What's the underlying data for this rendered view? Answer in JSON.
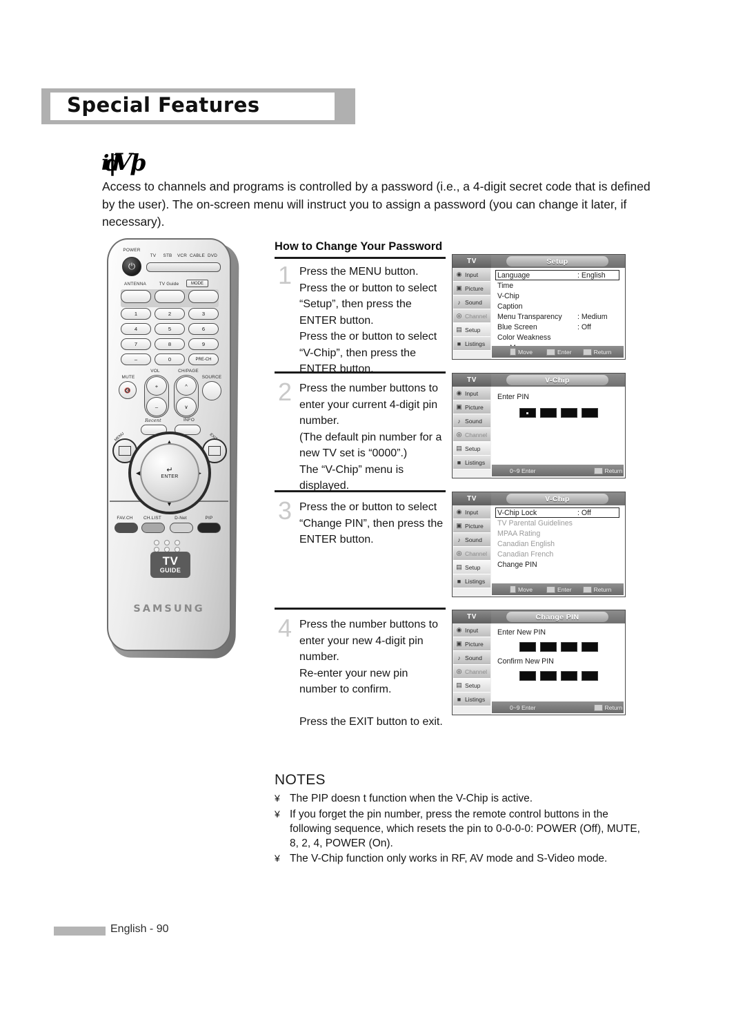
{
  "header": {
    "title": "Special Features"
  },
  "section": {
    "glyphs": [
      "i",
      "d",
      "V",
      "þ",
      "|"
    ],
    "intro": "Access to channels and programs is controlled by a password (i.e., a 4-digit secret code that is defined by the user). The on-screen menu will instruct you to assign a password (you can change it later, if necessary)."
  },
  "howto": {
    "title": "How to Change Your Password"
  },
  "steps": [
    {
      "num": "1",
      "text": "Press the MENU button.\nPress the      or      button to select “Setup”, then press the ENTER button.\nPress the      or      button to select “V-Chip”, then press the ENTER button."
    },
    {
      "num": "2",
      "text": "Press the number buttons to enter your current 4-digit pin number.\n(The default pin number for a new TV set is “0000”.)\nThe “V-Chip” menu is displayed."
    },
    {
      "num": "3",
      "text": "Press the      or      button to select “Change PIN”, then press the ENTER button."
    },
    {
      "num": "4",
      "text": "Press the number buttons to enter your new 4-digit pin number.\nRe-enter your new pin number to confirm.\n\nPress the EXIT button to exit."
    }
  ],
  "osd_sidebar": {
    "tv_label": "TV",
    "items": [
      {
        "label": "Input",
        "icon": "input-icon"
      },
      {
        "label": "Picture",
        "icon": "picture-icon"
      },
      {
        "label": "Sound",
        "icon": "sound-icon"
      },
      {
        "label": "Channel",
        "icon": "channel-icon"
      },
      {
        "label": "Setup",
        "icon": "setup-icon"
      },
      {
        "label": "Listings",
        "icon": "tvguide-icon"
      }
    ]
  },
  "osd_footer": {
    "move": "Move",
    "enter": "Enter",
    "return": "Return",
    "numeric": "0~9 Enter"
  },
  "osd_screens": [
    {
      "title": "Setup",
      "rows": [
        {
          "label": "Language",
          "value": ": English",
          "selected": true,
          "dim": false
        },
        {
          "label": "Time",
          "value": "",
          "selected": false,
          "dim": false
        },
        {
          "label": "V-Chip",
          "value": "",
          "selected": false,
          "dim": false
        },
        {
          "label": "Caption",
          "value": "",
          "selected": false,
          "dim": false
        },
        {
          "label": "Menu Transparency",
          "value": ": Medium",
          "selected": false,
          "dim": false
        },
        {
          "label": "Blue Screen",
          "value": ": Off",
          "selected": false,
          "dim": false
        },
        {
          "label": "Color Weakness",
          "value": "",
          "selected": false,
          "dim": false
        },
        {
          "label": "More",
          "value": "",
          "selected": false,
          "dim": false
        }
      ]
    },
    {
      "title": "V-Chip",
      "prompt": "Enter PIN",
      "pin_boxes": 4
    },
    {
      "title": "V-Chip",
      "rows": [
        {
          "label": "V-Chip Lock",
          "value": ": Off",
          "selected": true,
          "dim": false
        },
        {
          "label": "TV Parental Guidelines",
          "value": "",
          "selected": false,
          "dim": true
        },
        {
          "label": "MPAA Rating",
          "value": "",
          "selected": false,
          "dim": true
        },
        {
          "label": "Canadian English",
          "value": "",
          "selected": false,
          "dim": true
        },
        {
          "label": "Canadian French",
          "value": "",
          "selected": false,
          "dim": true
        },
        {
          "label": "Change PIN",
          "value": "",
          "selected": false,
          "dim": false
        }
      ]
    },
    {
      "title": "Change PIN",
      "prompt": "Enter New PIN",
      "prompt2": "Confirm New PIN",
      "pin_boxes": 4
    }
  ],
  "notes": {
    "heading": "NOTES",
    "bullet": "¥",
    "items": [
      "The PIP doesn t function when the V-Chip is active.",
      "If you forget the pin number, press the remote control buttons in the following sequence, which resets the pin to 0-0-0-0: POWER (Off), MUTE, 8, 2, 4, POWER (On).",
      "The V-Chip function only works in RF, AV mode and S-Video mode."
    ]
  },
  "remote": {
    "power_label": "POWER",
    "mode_devices": [
      "TV",
      "STB",
      "VCR",
      "CABLE",
      "DVD"
    ],
    "antenna_label": "ANTENNA",
    "tvguide_label": "TV Guide",
    "mode_label": "MODE",
    "keys": [
      "1",
      "2",
      "3",
      "4",
      "5",
      "6",
      "7",
      "8",
      "9",
      "–",
      "0",
      "PRE-CH"
    ],
    "mute_label": "MUTE",
    "vol_label": "VOL",
    "chpage_label": "CH/PAGE",
    "source_label": "SOURCE",
    "info_label": "INFO",
    "menu_label": "MENU",
    "exit_label": "EXIT",
    "enter_label": "ENTER",
    "bottom_keys": [
      "FAV.CH",
      "CH.LIST",
      "D-Net",
      "PIP"
    ],
    "brand": "SAMSUNG",
    "guide_top": "TV",
    "guide_bottom": "GUIDE"
  },
  "footer": {
    "page": "English - 90"
  }
}
